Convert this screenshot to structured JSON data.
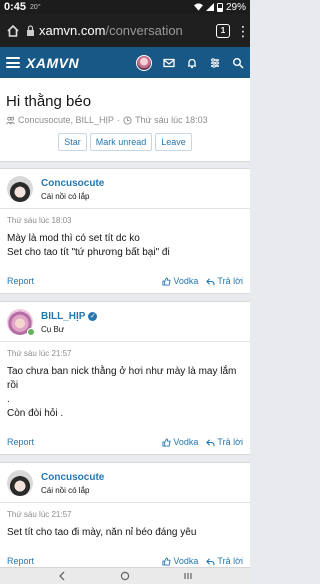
{
  "status": {
    "time": "0:45",
    "temp": "20°",
    "battery": "29%"
  },
  "browser": {
    "url_host": "xamvn.com",
    "url_path": "/conversation",
    "tab_count": "1"
  },
  "site": {
    "logo": "XAMVN"
  },
  "thread": {
    "title": "Hi thằng béo",
    "participants": "Concusocute, BILL_HỊP",
    "date": "Thứ sáu lúc 18:03",
    "actions": [
      "Star",
      "Mark unread",
      "Leave"
    ]
  },
  "posts": [
    {
      "username": "Concusocute",
      "user_title": "Cái nồi có lắp",
      "date": "Thứ sáu lúc 18:03",
      "lines": [
        "Mày là mod thì có set tít dc ko",
        "Set cho tao tít \"tứ phương bất bại\" đi"
      ],
      "reaction": "Vodka",
      "reply": "Trả lời",
      "report": "Report"
    },
    {
      "username": "BILL_HỊP",
      "user_title": "Cụ Bư",
      "date": "Thứ sáu lúc 21:57",
      "lines": [
        "Tao chưa ban nick thằng ở hơi như mày là may lắm rồi",
        ".",
        "Còn đòi hỏi ."
      ],
      "reaction": "Vodka",
      "reply": "Trả lời",
      "report": "Report"
    },
    {
      "username": "Concusocute",
      "user_title": "Cái nồi có lắp",
      "date": "Thứ sáu lúc 21:57",
      "lines": [
        "Set tít cho tao đi mày, năn nỉ béo đáng yêu"
      ],
      "reaction": "Vodka",
      "reply": "Trả lời",
      "report": "Report"
    }
  ],
  "icons": [
    "home-icon",
    "lock-icon",
    "tabs-icon",
    "more-icon",
    "menu-icon",
    "mail-icon",
    "bell-icon",
    "gear-icon",
    "search-icon",
    "users-icon",
    "clock-icon",
    "thumbs-up-icon",
    "reply-icon",
    "verified-icon",
    "back-icon",
    "home-button-icon",
    "recents-icon"
  ],
  "colors": {
    "header": "#185886",
    "link": "#2577b1",
    "online": "#63b359"
  }
}
